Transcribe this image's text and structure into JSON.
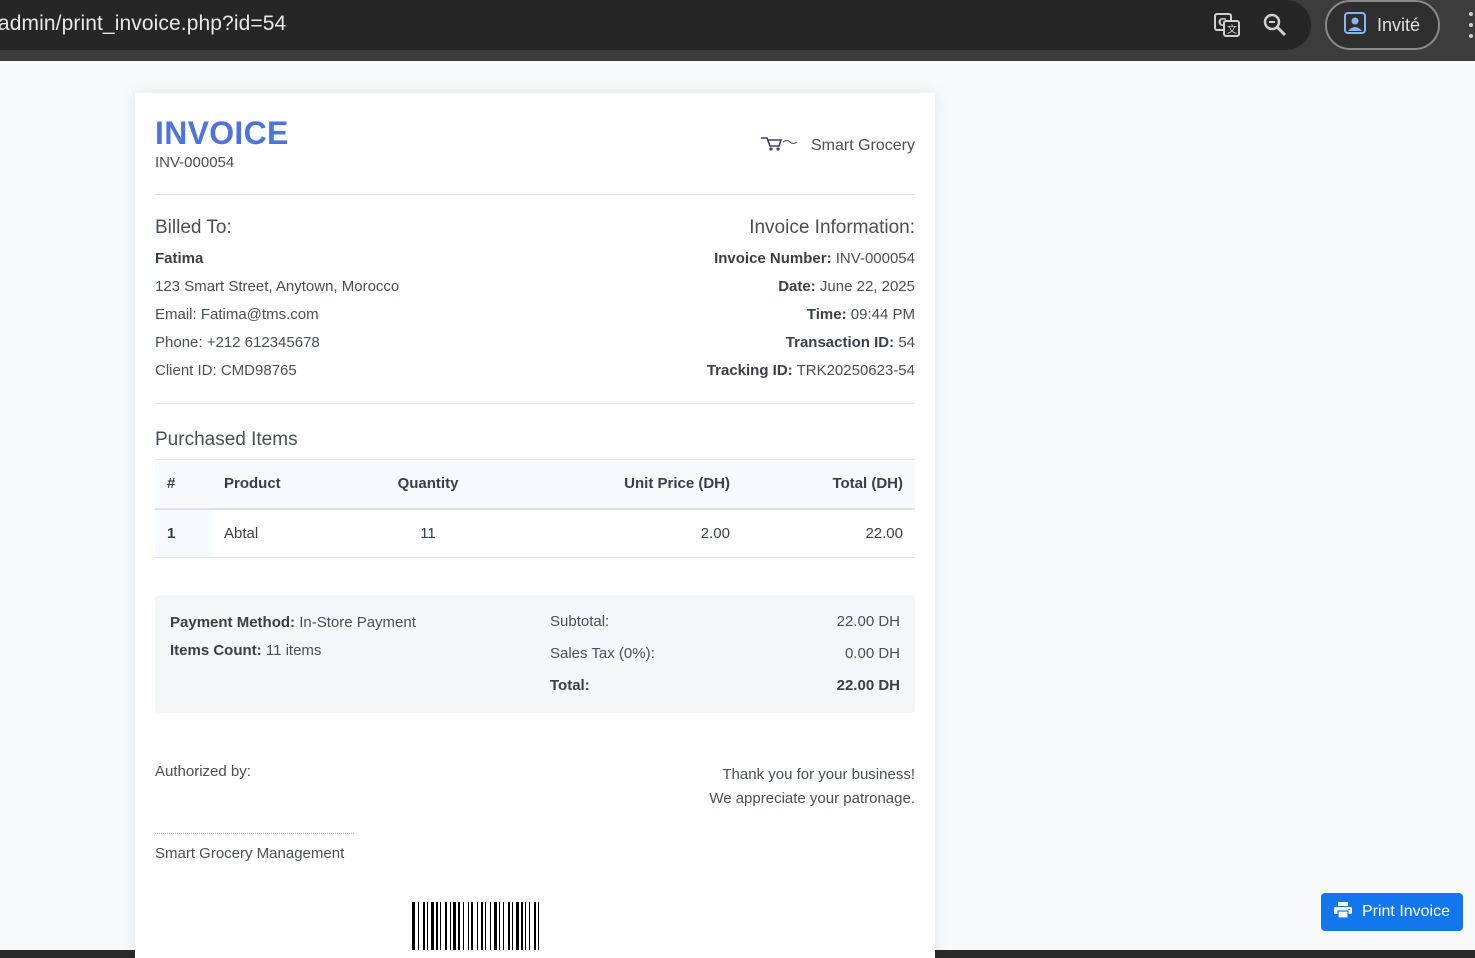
{
  "browser": {
    "url": "/admin/print_invoice.php?id=54",
    "profile_label": "Invité"
  },
  "invoice": {
    "title": "INVOICE",
    "number": "INV-000054",
    "brand_name": "Smart Grocery"
  },
  "billed_to": {
    "heading": "Billed To:",
    "name": "Fatima",
    "address": "123 Smart Street, Anytown, Morocco",
    "email": "Email: Fatima@tms.com",
    "phone": "Phone: +212 612345678",
    "client_id": "Client ID: CMD98765"
  },
  "info": {
    "heading": "Invoice Information:",
    "invoice_number_label": "Invoice Number:",
    "invoice_number": "INV-000054",
    "date_label": "Date:",
    "date": "June 22, 2025",
    "time_label": "Time:",
    "time": "09:44 PM",
    "transaction_label": "Transaction ID:",
    "transaction_id": "54",
    "tracking_label": "Tracking ID:",
    "tracking_id": "TRK20250623-54"
  },
  "items": {
    "heading": "Purchased Items",
    "columns": [
      "#",
      "Product",
      "Quantity",
      "Unit Price (DH)",
      "Total (DH)"
    ],
    "rows": [
      {
        "num": "1",
        "product": "Abtal",
        "qty": "11",
        "unit": "2.00",
        "total": "22.00"
      }
    ]
  },
  "summary": {
    "payment_label": "Payment Method:",
    "payment_value": "In-Store Payment",
    "count_label": "Items Count:",
    "count_value": "11 items",
    "subtotal_label": "Subtotal:",
    "subtotal_value": "22.00 DH",
    "tax_label": "Sales Tax (0%):",
    "tax_value": "0.00 DH",
    "total_label": "Total:",
    "total_value": "22.00 DH"
  },
  "footer": {
    "authorized_label": "Authorized by:",
    "thanks_1": "Thank you for your business!",
    "thanks_2": "We appreciate your patronage.",
    "signer": "Smart Grocery Management"
  },
  "print_button": "Print Invoice",
  "colors": {
    "accent": "#4e73df",
    "button": "#1276ec"
  }
}
